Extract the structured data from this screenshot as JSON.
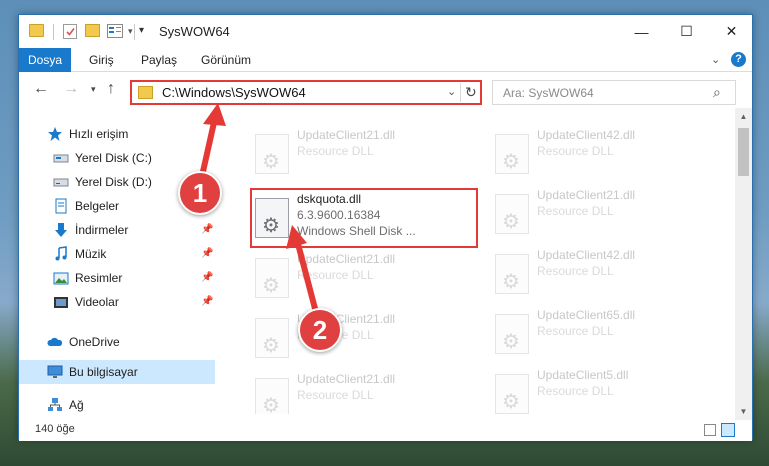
{
  "window": {
    "title": "SysWOW64",
    "minimize_glyph": "—",
    "maximize_glyph": "☐",
    "close_glyph": "✕"
  },
  "ribbon": {
    "tabs": [
      "Dosya",
      "Giriş",
      "Paylaş",
      "Görünüm"
    ],
    "help_label": "?"
  },
  "navbar": {
    "address": "C:\\Windows\\SysWOW64",
    "search_placeholder": "Ara: SysWOW64"
  },
  "navpane": {
    "items": [
      {
        "label": "Hızlı erişim",
        "icon": "star-icon",
        "pinned": false
      },
      {
        "label": "Yerel Disk (C:)",
        "icon": "drive-icon",
        "pinned": true
      },
      {
        "label": "Yerel Disk (D:)",
        "icon": "drive-icon",
        "pinned": true
      },
      {
        "label": "Belgeler",
        "icon": "documents-icon",
        "pinned": true
      },
      {
        "label": "İndirmeler",
        "icon": "downloads-icon",
        "pinned": true
      },
      {
        "label": "Müzik",
        "icon": "music-icon",
        "pinned": true
      },
      {
        "label": "Resimler",
        "icon": "pictures-icon",
        "pinned": true
      },
      {
        "label": "Videolar",
        "icon": "videos-icon",
        "pinned": true
      },
      {
        "label": "OneDrive",
        "icon": "onedrive-icon",
        "pinned": false
      },
      {
        "label": "Bu bilgisayar",
        "icon": "this-pc-icon",
        "pinned": false,
        "selected": true
      },
      {
        "label": "Ağ",
        "icon": "network-icon",
        "pinned": false
      }
    ]
  },
  "files": {
    "left": [
      {
        "name": "UpdateClient21.dll",
        "line2": "Resource DLL",
        "line3": ""
      },
      {
        "name": "dskquota.dll",
        "line2": "6.3.9600.16384",
        "line3": "Windows Shell Disk ...",
        "focus": true
      },
      {
        "name": "UpdateClient21.dll",
        "line2": "Resource DLL",
        "line3": ""
      },
      {
        "name": "UpdateClient21.dll",
        "line2": "Resource DLL",
        "line3": ""
      },
      {
        "name": "UpdateClient21.dll",
        "line2": "Resource DLL",
        "line3": ""
      }
    ],
    "right": [
      {
        "name": "UpdateClient42.dll",
        "line2": "Resource DLL"
      },
      {
        "name": "UpdateClient21.dll",
        "line2": "Resource DLL"
      },
      {
        "name": "UpdateClient42.dll",
        "line2": "Resource DLL"
      },
      {
        "name": "UpdateClient65.dll",
        "line2": "Resource DLL"
      },
      {
        "name": "UpdateClient5.dll",
        "line2": "Resource DLL"
      }
    ]
  },
  "statusbar": {
    "count": "140 öğe"
  },
  "annotations": {
    "badge1": "1",
    "badge2": "2",
    "accent": "#e53935"
  }
}
